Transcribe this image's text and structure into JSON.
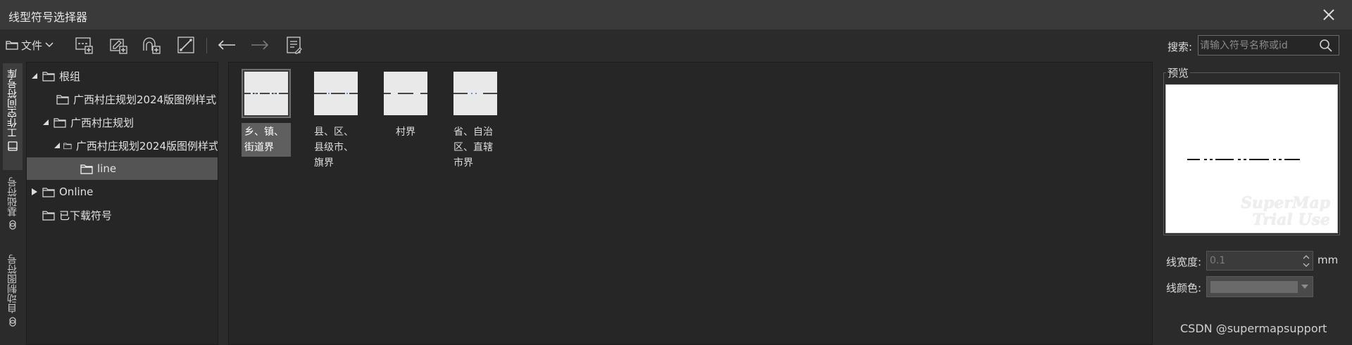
{
  "window": {
    "title": "线型符号选择器"
  },
  "toolbar": {
    "file_label": "文件"
  },
  "search": {
    "label": "搜索:",
    "placeholder": "请输入符号名称或id"
  },
  "vtabs": [
    {
      "label": "工作空间符号库",
      "active": true
    },
    {
      "label": "基础符号",
      "active": false
    },
    {
      "label": "自动制图符号",
      "active": false
    }
  ],
  "tree": [
    {
      "label": "根组",
      "level": 0,
      "arrow": "expanded",
      "selected": false
    },
    {
      "label": "广西村庄规划2024版图例样式",
      "level": 1,
      "arrow": "none",
      "selected": false
    },
    {
      "label": "广西村庄规划",
      "level": 1,
      "arrow": "expanded",
      "selected": false
    },
    {
      "label": "广西村庄规划2024版图例样式",
      "level": 2,
      "arrow": "expanded",
      "selected": false
    },
    {
      "label": "line",
      "level": 3,
      "arrow": "none",
      "selected": true
    },
    {
      "label": "Online",
      "level": 0,
      "arrow": "collapsed",
      "selected": false
    },
    {
      "label": "已下载符号",
      "level": 0,
      "arrow": "none",
      "selected": false
    }
  ],
  "symbols": [
    {
      "label": "乡、镇、街道界",
      "selected": true
    },
    {
      "label": "县、区、县级市、旗界",
      "selected": false
    },
    {
      "label": "村界",
      "selected": false
    },
    {
      "label": "省、自治区、直辖市界",
      "selected": false
    }
  ],
  "preview": {
    "title": "预览",
    "watermark_line1": "SuperMap",
    "watermark_line2": "Trial Use"
  },
  "properties": {
    "width_label": "线宽度:",
    "width_value": "0.1",
    "width_unit": "mm",
    "color_label": "线颜色:"
  },
  "credit": "CSDN @supermapsupport"
}
